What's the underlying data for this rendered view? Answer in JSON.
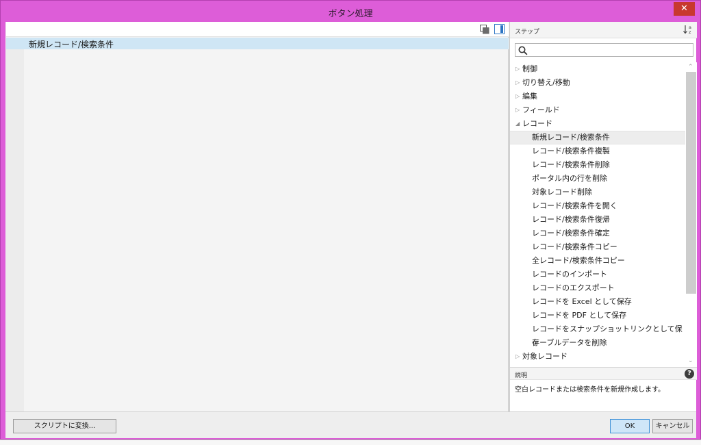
{
  "window": {
    "title": "ボタン処理",
    "close_label": "✕",
    "accent_color": "#dd5dd8",
    "selection_color": "#cfe6f5"
  },
  "editor": {
    "script_lines": [
      "新規レコード/検索条件"
    ]
  },
  "steps_panel": {
    "header": "ステップ",
    "sort_icon": "sort-az-icon",
    "search_placeholder": "",
    "categories": [
      {
        "label": "制御",
        "state": "collapsed"
      },
      {
        "label": "切り替え/移動",
        "state": "collapsed"
      },
      {
        "label": "編集",
        "state": "collapsed"
      },
      {
        "label": "フィールド",
        "state": "collapsed"
      },
      {
        "label": "レコード",
        "state": "expanded"
      }
    ],
    "record_steps": [
      "新規レコード/検索条件",
      "レコード/検索条件複製",
      "レコード/検索条件削除",
      "ポータル内の行を削除",
      "対象レコード削除",
      "レコード/検索条件を開く",
      "レコード/検索条件復帰",
      "レコード/検索条件確定",
      "レコード/検索条件コピー",
      "全レコード/検索条件コピー",
      "レコードのインポート",
      "レコードのエクスポート",
      "レコードを Excel として保存",
      "レコードを PDF として保存",
      "レコードをスナップショットリンクとして保存",
      "テーブルデータを削除"
    ],
    "selected_step": "新規レコード/検索条件",
    "trailing_category": {
      "label": "対象レコード",
      "state": "collapsed"
    }
  },
  "description": {
    "header": "説明",
    "text": "空白レコードまたは検索条件を新規作成します。"
  },
  "footer": {
    "convert_label": "スクリプトに変換...",
    "ok_label": "OK",
    "cancel_label": "キャンセル"
  }
}
